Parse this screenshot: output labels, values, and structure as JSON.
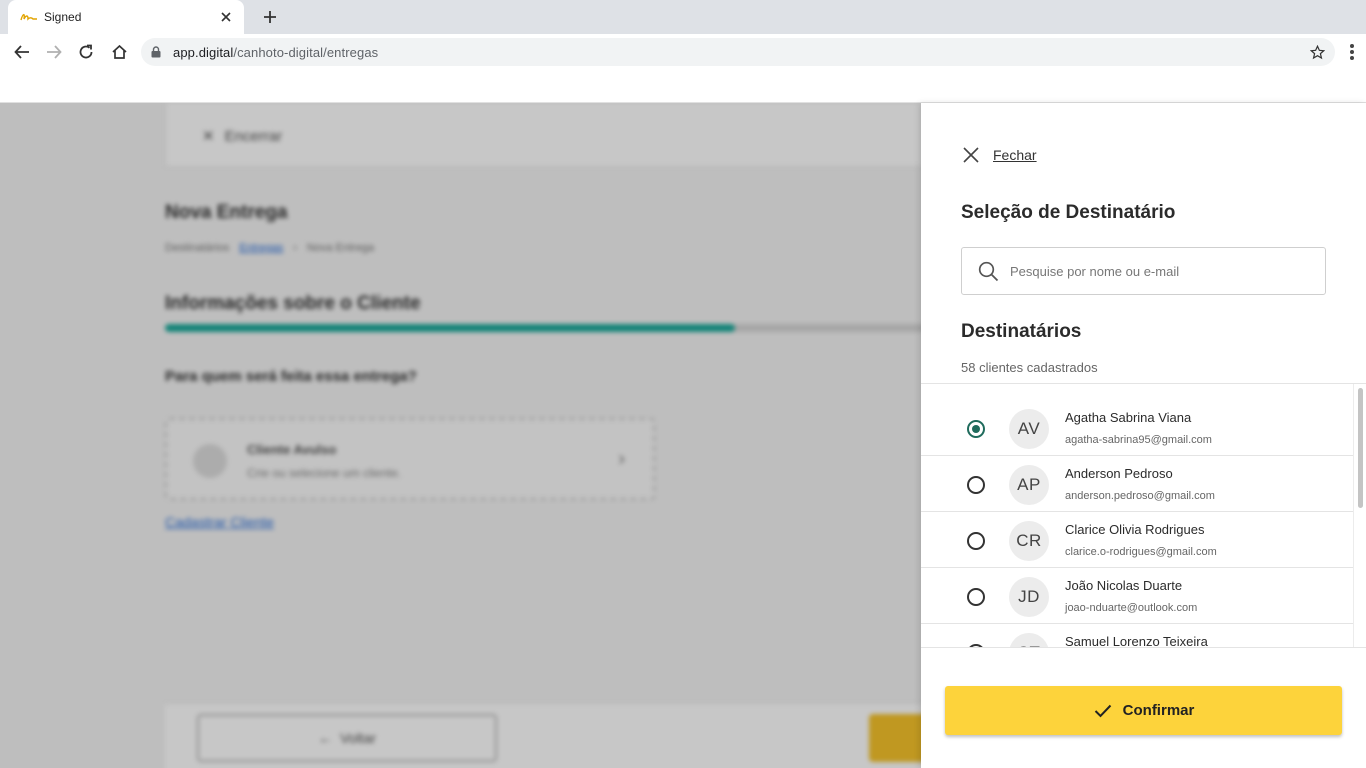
{
  "browser": {
    "tab_title": "Signed",
    "url_host": "app.digital",
    "url_path": "/canhoto-digital/entregas"
  },
  "background": {
    "cancel_label": "Encerrar",
    "page_title": "Nova Entrega",
    "breadcrumb": [
      "Destinatários",
      "Entregas",
      "Nova Entrega"
    ],
    "section_title": "Informações sobre o Cliente",
    "progress_fraction": 0.75,
    "question": "Para quem será feita essa entrega?",
    "client_box_title": "Cliente Avulso",
    "client_box_sub": "Crie ou selecione um cliente.",
    "register_link": "Cadastrar Cliente",
    "back_label": "Voltar"
  },
  "drawer": {
    "close_label": "Fechar",
    "title": "Seleção de Destinatário",
    "search_placeholder": "Pesquise por nome ou e-mail",
    "recipients_title": "Destinatários",
    "recipients_count": "58 clientes cadastrados",
    "confirm_label": "Confirmar",
    "accent_color": "#1f6b5c",
    "confirm_color": "#fdd33b"
  },
  "recipients": [
    {
      "initials": "AV",
      "name": "Agatha Sabrina Viana",
      "email": "agatha-sabrina95@gmail.com",
      "selected": true
    },
    {
      "initials": "AP",
      "name": "Anderson Pedroso",
      "email": "anderson.pedroso@gmail.com",
      "selected": false
    },
    {
      "initials": "CR",
      "name": "Clarice Olivia Rodrigues",
      "email": "clarice.o-rodrigues@gmail.com",
      "selected": false
    },
    {
      "initials": "JD",
      "name": "João Nicolas Duarte",
      "email": "joao-nduarte@outlook.com",
      "selected": false
    },
    {
      "initials": "ST",
      "name": "Samuel Lorenzo Teixeira",
      "email": "",
      "selected": false
    }
  ]
}
